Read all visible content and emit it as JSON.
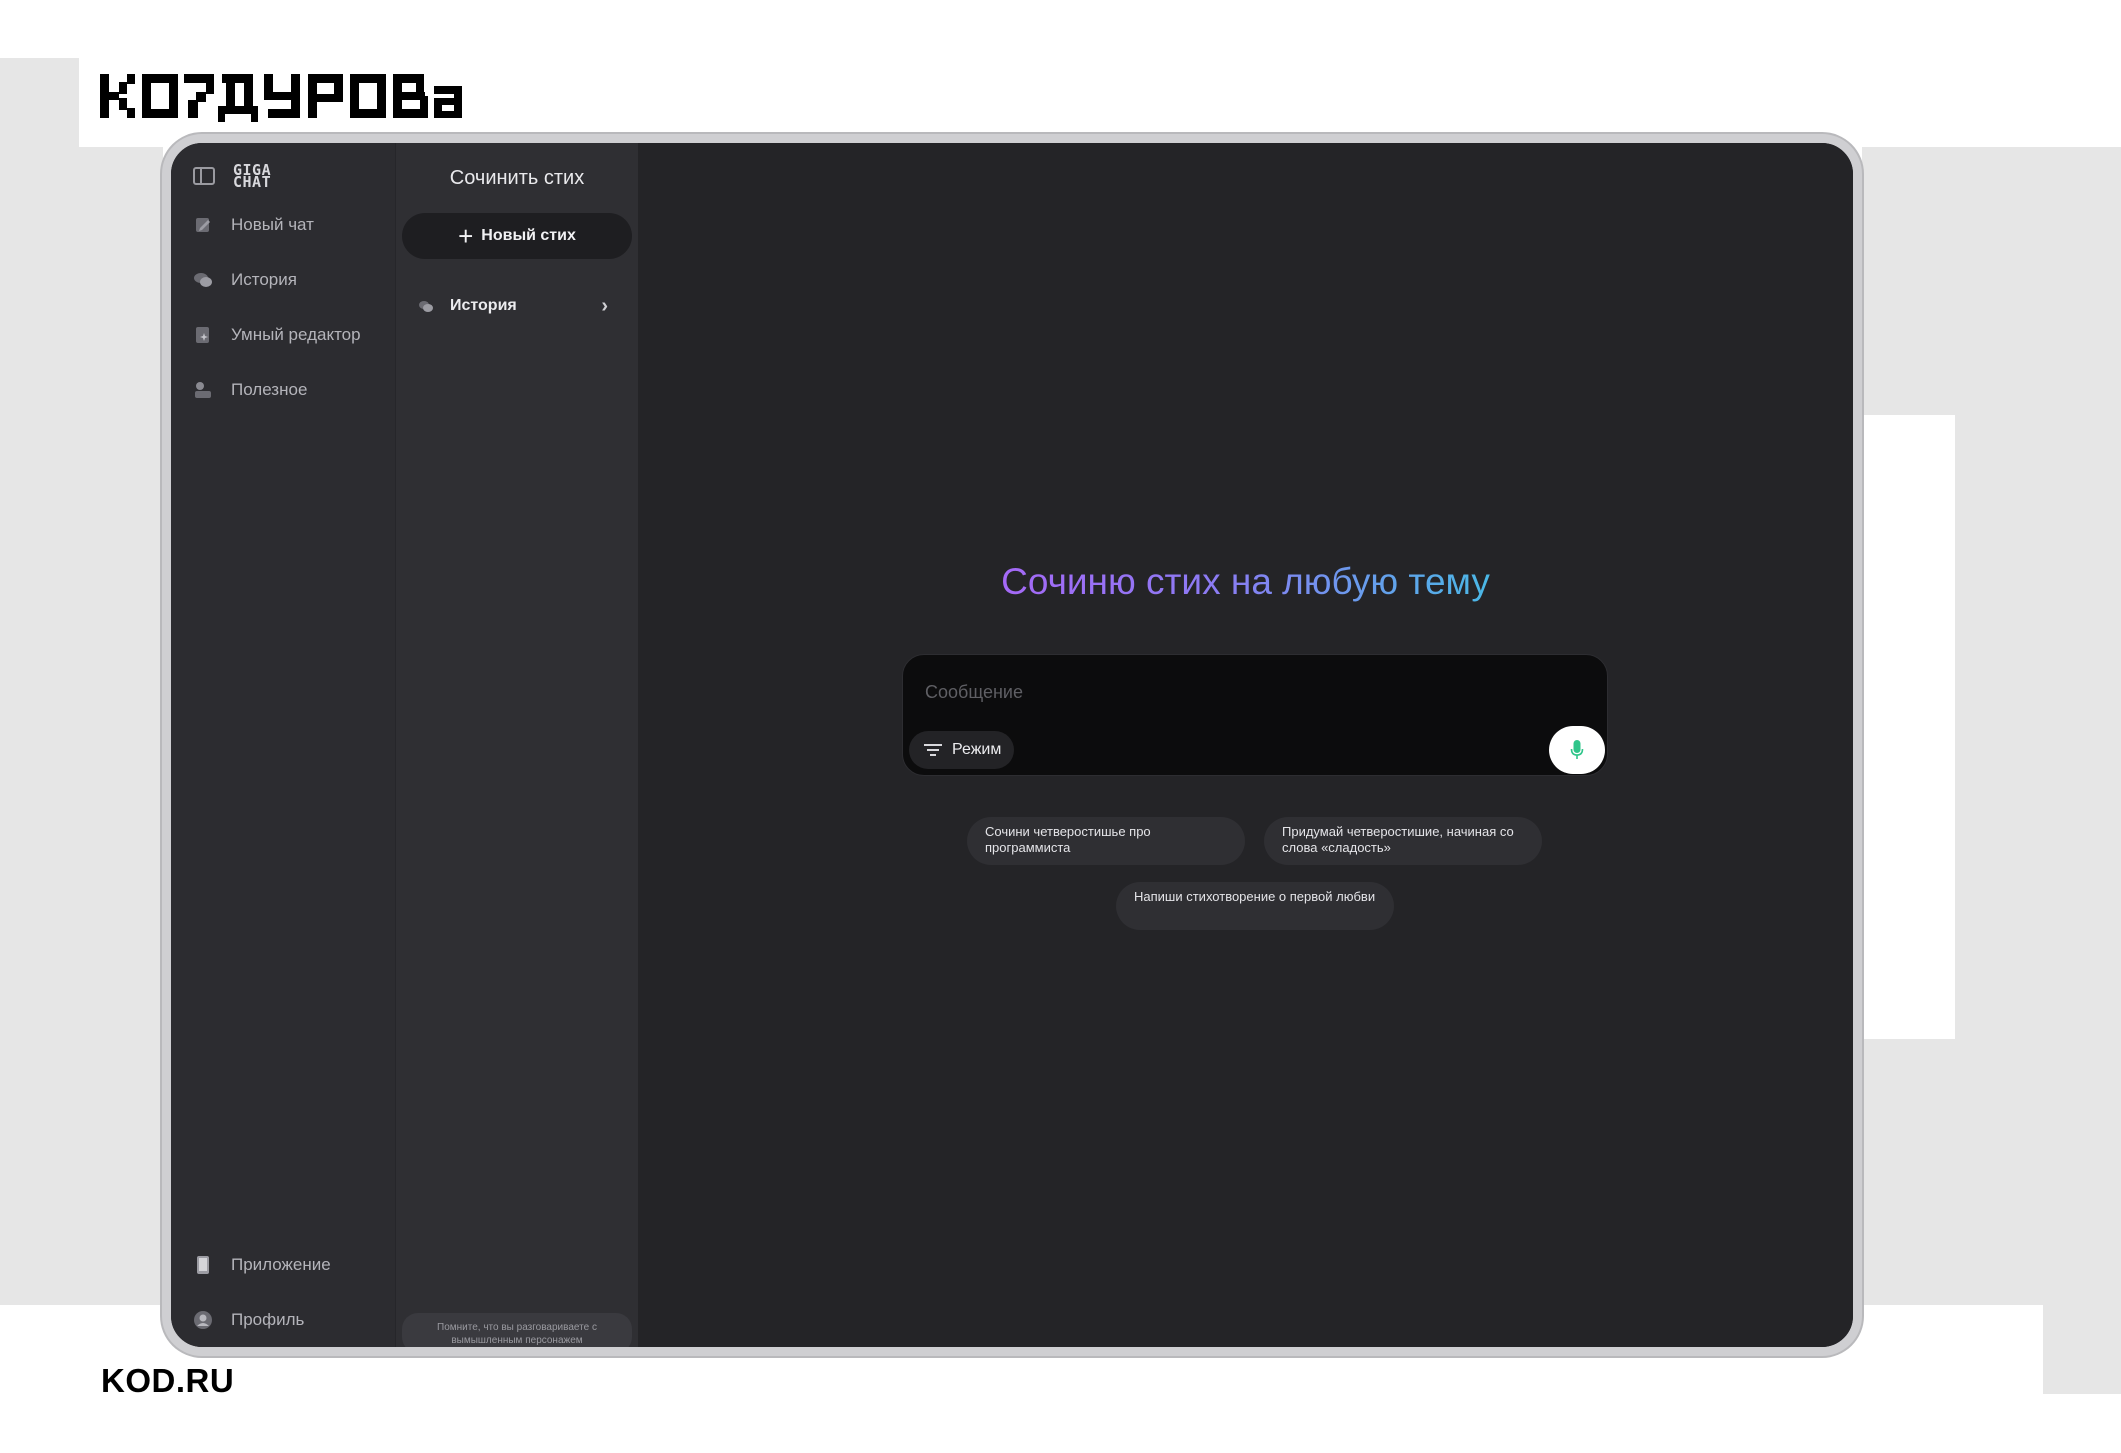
{
  "brand": {
    "logo_text": "КОДУРОВА",
    "footer": "KOD.RU"
  },
  "colors": {
    "window_bg": "#242427",
    "nav_bg": "#2c2c30",
    "panel_bg": "#2f2f33",
    "composer_bg": "#0c0c0d",
    "headline_gradient_start": "#a569f7",
    "headline_gradient_end": "#4ab8e6",
    "mic_accent": "#2fc58a"
  },
  "nav": {
    "logo_text": "GIGA CHAT",
    "items": [
      {
        "label": "Новый чат",
        "icon": "pencil-icon"
      },
      {
        "label": "История",
        "icon": "chat-bubbles-icon"
      },
      {
        "label": "Умный редактор",
        "icon": "smart-editor-icon"
      },
      {
        "label": "Полезное",
        "icon": "useful-icon"
      }
    ],
    "bottom_items": [
      {
        "label": "Приложение",
        "icon": "phone-icon"
      },
      {
        "label": "Профиль",
        "icon": "user-icon"
      }
    ]
  },
  "panel": {
    "title": "Сочинить стих",
    "new_button": "Новый стих",
    "history_label": "История",
    "disclaimer": "Помните, что вы разговариваете с вымышленным персонажем"
  },
  "main": {
    "headline": "Сочиню стих на любую тему",
    "composer": {
      "placeholder": "Сообщение",
      "mode_label": "Режим"
    },
    "suggestions": [
      "Сочини четверостишье про программиста",
      "Придумай четверостишие, начиная со слова «сладость»",
      "Напиши стихотворение о первой любви"
    ]
  }
}
